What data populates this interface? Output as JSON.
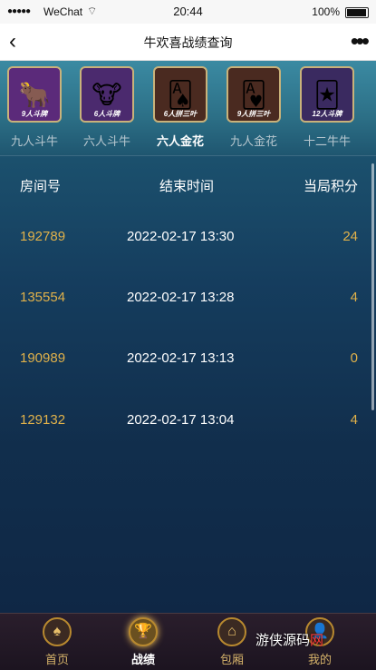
{
  "statusbar": {
    "signal": "●●●●●",
    "carrier": "WeChat",
    "wifi": "⌔",
    "time": "20:44",
    "battery": "100%"
  },
  "navbar": {
    "back": "‹",
    "title": "牛欢喜战绩查询",
    "more": "•••"
  },
  "games": [
    {
      "label": "九人斗牛",
      "tag": "9人斗牌",
      "emoji": "🐂",
      "color": "#5b2a7a"
    },
    {
      "label": "六人斗牛",
      "tag": "6人斗牌",
      "emoji": "🐮",
      "color": "#4b2a6e"
    },
    {
      "label": "六人金花",
      "tag": "6人拼三叶",
      "emoji": "🂡",
      "color": "#4a2a20"
    },
    {
      "label": "九人金花",
      "tag": "9人拼三叶",
      "emoji": "🂱",
      "color": "#4a2a20"
    },
    {
      "label": "十二牛牛",
      "tag": "12人斗牌",
      "emoji": "🃏",
      "color": "#3a2a60"
    }
  ],
  "table": {
    "headers": {
      "room": "房间号",
      "end_time": "结束时间",
      "score": "当局积分"
    },
    "rows": [
      {
        "room": "192789",
        "time": "2022-02-17 13:30",
        "score": "24"
      },
      {
        "room": "135554",
        "time": "2022-02-17 13:28",
        "score": "4"
      },
      {
        "room": "190989",
        "time": "2022-02-17 13:13",
        "score": "0"
      },
      {
        "room": "129132",
        "time": "2022-02-17 13:04",
        "score": "4"
      }
    ]
  },
  "tabs": [
    {
      "label": "首页",
      "icon": "♠"
    },
    {
      "label": "战绩",
      "icon": "🏆"
    },
    {
      "label": "包厢",
      "icon": "⌂"
    },
    {
      "label": "我的",
      "icon": "👤"
    }
  ],
  "watermark": {
    "text": "游侠源码",
    "suffix": "网"
  }
}
